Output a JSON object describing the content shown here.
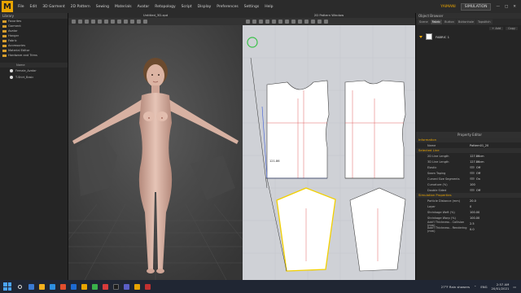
{
  "app": {
    "logo": "M",
    "menus": [
      "File",
      "Edit",
      "3D Garment",
      "2D Pattern",
      "Sewing",
      "Materials",
      "Avatar",
      "Retopology",
      "Script",
      "Display",
      "Preferences",
      "Settings",
      "Help"
    ],
    "user": "YAIMANI",
    "mode": "SIMULATION",
    "window_title_3d": "Untitled_3D.zpd",
    "window_title_2d": "2D Pattern Window"
  },
  "library": {
    "title": "Library",
    "items": [
      "Favorites",
      "Garment",
      "Avatar",
      "Hanger",
      "Fabric",
      "Accessories",
      "Material Editor",
      "Hardware and Trims"
    ],
    "column_header": "Name",
    "files": [
      "Female_Avatar",
      "T-Shirt_Basic"
    ]
  },
  "object_browser": {
    "title": "Object Browser",
    "tabs": [
      "Scene",
      "Fabric",
      "Button",
      "Buttonhole",
      "Topstitch"
    ],
    "active_tab": "Fabric",
    "add_label": "+ Add",
    "copy_label": "Copy",
    "fabric_name": "FABRIC 1"
  },
  "property_editor": {
    "title": "Property Editor",
    "sections": {
      "information": "Information",
      "selected_line": "Selected Line",
      "simulation": "Simulation Properties"
    },
    "info_rows": [
      {
        "k": "Name",
        "v": "Pattern01_20"
      }
    ],
    "line_rows": [
      {
        "k": "2D Line Length",
        "v": "127.86cm"
      },
      {
        "k": "3D Line Length",
        "v": "127.86cm"
      },
      {
        "k": "Elastic",
        "v": "Off"
      },
      {
        "k": "Seam Taping",
        "v": "Off"
      },
      {
        "k": "Curved Size Segments",
        "v": "On"
      },
      {
        "k": "Curvature (%)",
        "v": "100"
      },
      {
        "k": "Double Sided",
        "v": "Off"
      }
    ],
    "sim_rows": [
      {
        "k": "Particle Distance (mm)",
        "v": "20.0"
      },
      {
        "k": "Layer",
        "v": "0"
      },
      {
        "k": "Shrinkage Weft (%)",
        "v": "100.00"
      },
      {
        "k": "Shrinkage Warp (%)",
        "v": "100.00"
      },
      {
        "k": "Add'l Thickness - Collision (mm)",
        "v": "2.5"
      },
      {
        "k": "Add'l Thickness - Rendering (mm)",
        "v": "0.0"
      }
    ]
  },
  "pattern": {
    "measure_label": "121.86"
  },
  "taskbar": {
    "weather": "27°F  Rain showers",
    "lang": "ENG",
    "time": "2:57 AM",
    "date": "20/01/2021"
  },
  "colors": {
    "accent": "#e8a400",
    "viewport_bg": "#3d3d3d",
    "pattern_bg": "#cfd1d6",
    "pattern_fill": "#ffffff",
    "selected_line": "#f2d000"
  }
}
